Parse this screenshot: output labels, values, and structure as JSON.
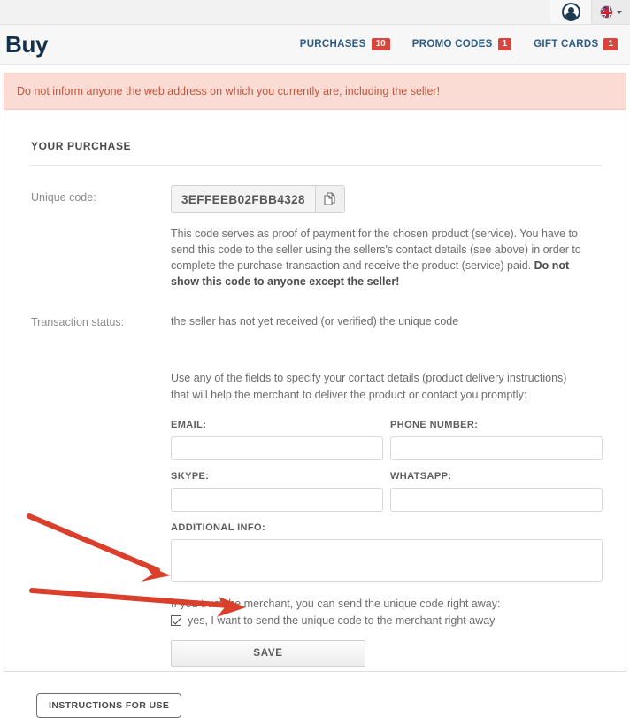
{
  "topbar": {
    "avatar_icon": "user-avatar-icon",
    "language_flag": "uk-flag-icon",
    "language_chevron": "chevron-down-icon"
  },
  "header": {
    "brand": "Buy",
    "nav": [
      {
        "label": "PURCHASES",
        "badge": "10"
      },
      {
        "label": "PROMO CODES",
        "badge": "1"
      },
      {
        "label": "GIFT CARDS",
        "badge": "1"
      }
    ]
  },
  "alert": {
    "text": "Do not inform anyone the web address on which you currently are, including the seller!"
  },
  "card": {
    "section_title": "YOUR PURCHASE",
    "unique_code": {
      "label": "Unique code:",
      "value": "3EFFEEB02FBB4328",
      "copy_icon": "copy-icon",
      "description_plain": "This code serves as proof of payment for the chosen product (service). You have to send this code to the seller using the sellers's contact details (see above) in order to complete the purchase transaction and receive the product (service) paid. ",
      "description_bold": "Do not show this code to anyone except the seller!"
    },
    "transaction_status": {
      "label": "Transaction status:",
      "value": "the seller has not yet received (or verified) the unique code"
    },
    "contact_intro": "Use any of the fields to specify your contact details (product delivery instructions) that will help the merchant to deliver the product or contact you promptly:",
    "fields": {
      "email_label": "EMAIL:",
      "email_value": "",
      "phone_label": "PHONE NUMBER:",
      "phone_value": "",
      "skype_label": "SKYPE:",
      "skype_value": "",
      "whatsapp_label": "WHATSAPP:",
      "whatsapp_value": "",
      "additional_label": "ADDITIONAL INFO:",
      "additional_value": ""
    },
    "trust": {
      "text": "If you trust the merchant, you can send the unique code right away:",
      "checkbox_label": "yes, I want to send the unique code to the merchant right away",
      "checked": true
    },
    "save_label": "SAVE",
    "instructions_label": "INSTRUCTIONS FOR USE"
  },
  "annotations": {
    "arrow_color": "#d93f2b",
    "arrow_checkbox": "arrow-pointing-to-checkbox",
    "arrow_save": "arrow-pointing-to-save-button"
  }
}
